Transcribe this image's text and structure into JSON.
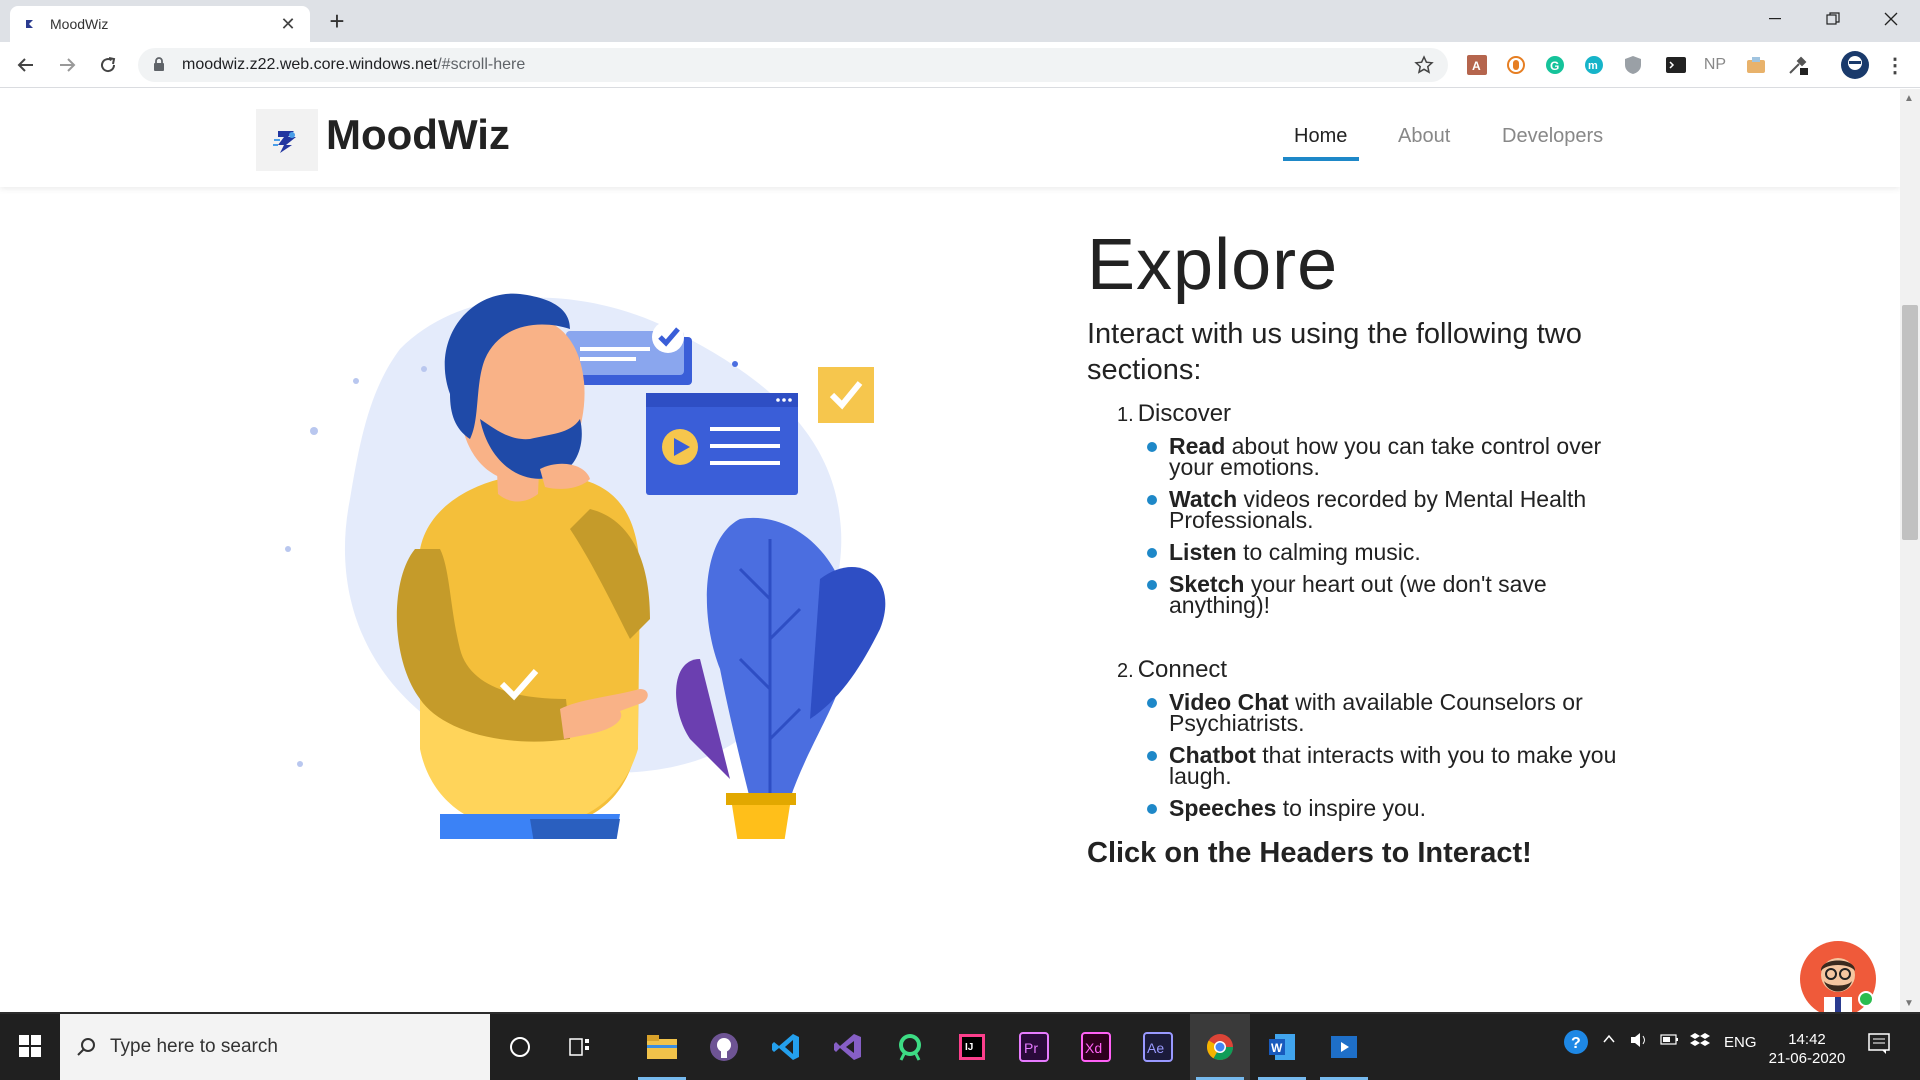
{
  "browser": {
    "tab_title": "MoodWiz",
    "url_host": "moodwiz.z22.web.core.windows.net",
    "url_path": "/#scroll-here",
    "extensions": [
      "pdf-icon",
      "clip-icon",
      "grammarly-icon",
      "m-icon",
      "shield-icon",
      "terminal-icon",
      "NP",
      "tag-icon",
      "eyedropper-icon"
    ]
  },
  "site": {
    "brand": "MoodWiz",
    "nav": [
      {
        "label": "Home",
        "active": true
      },
      {
        "label": "About",
        "active": false
      },
      {
        "label": "Developers",
        "active": false
      }
    ]
  },
  "main": {
    "heading": "Explore",
    "intro": "Interact with us using the following two sections:",
    "sections": [
      {
        "number": "1.",
        "title": "Discover",
        "items": [
          {
            "bold": "Read",
            "text": " about how you can take control over your emotions."
          },
          {
            "bold": "Watch",
            "text": " videos recorded by Mental Health Professionals."
          },
          {
            "bold": "Listen",
            "text": " to calming music."
          },
          {
            "bold": "Sketch",
            "text": " your heart out (we don't save anything)!"
          }
        ]
      },
      {
        "number": "2.",
        "title": "Connect",
        "items": [
          {
            "bold": "Video Chat",
            "text": " with available Counselors or Psychiatrists."
          },
          {
            "bold": "Chatbot",
            "text": " that interacts with you to make you laugh."
          },
          {
            "bold": "Speeches",
            "text": " to inspire you."
          }
        ]
      }
    ],
    "cta": "Click on the Headers to Interact!"
  },
  "taskbar": {
    "search_placeholder": "Type here to search",
    "language": "ENG",
    "time": "14:42",
    "date": "21-06-2020"
  },
  "colors": {
    "accent": "#1e88c8",
    "taskbar": "#202020"
  }
}
